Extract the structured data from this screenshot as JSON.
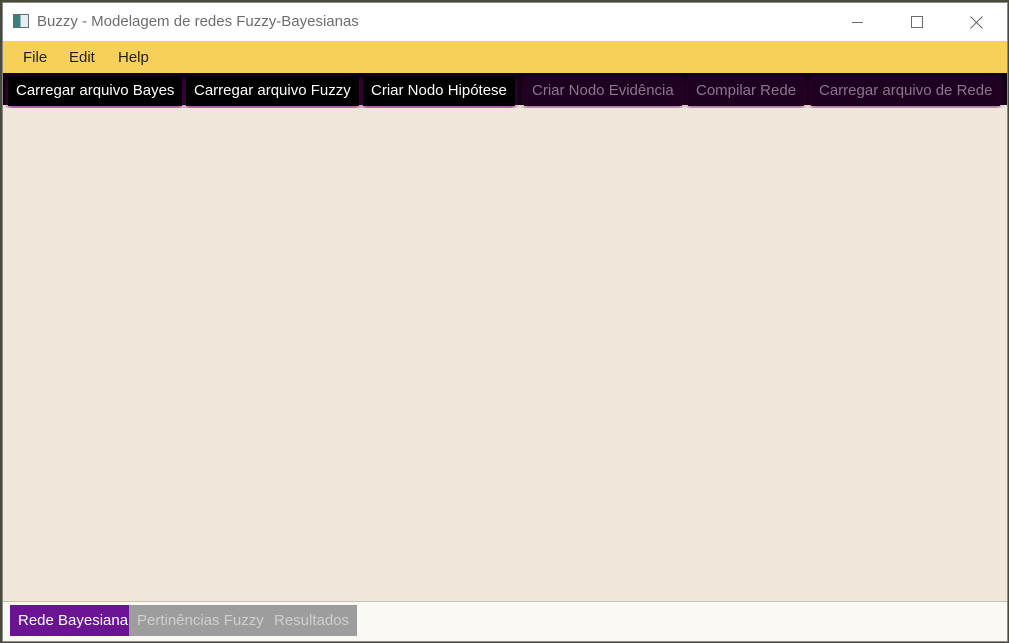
{
  "window": {
    "title": "Buzzy - Modelagem de redes Fuzzy-Bayesianas"
  },
  "menu": {
    "items": [
      {
        "label": "File"
      },
      {
        "label": "Edit"
      },
      {
        "label": "Help"
      }
    ]
  },
  "toolbar": {
    "buttons": [
      {
        "label": "Carregar arquivo Bayes",
        "enabled": true
      },
      {
        "label": "Carregar arquivo Fuzzy",
        "enabled": true
      },
      {
        "label": "Criar Nodo Hipótese",
        "enabled": true
      },
      {
        "label": "Criar Nodo Evidência",
        "enabled": false
      },
      {
        "label": "Compilar Rede",
        "enabled": false
      },
      {
        "label": "Carregar arquivo de Rede",
        "enabled": false
      }
    ]
  },
  "tabs": [
    {
      "label": "Rede Bayesiana",
      "selected": true
    },
    {
      "label": "Pertinências Fuzzy",
      "selected": false
    },
    {
      "label": "Resultados",
      "selected": false
    }
  ],
  "colors": {
    "menubar": "#f7d05a",
    "toolbar_button": "#000000",
    "toolbar_glow": "#820082",
    "canvas": "#efe7d9",
    "active_tab": "#6a1494",
    "inactive_tab": "#9d9d9d"
  },
  "icons": {
    "app": "app-window-icon",
    "minimize": "minimize-icon",
    "maximize": "maximize-icon",
    "close": "close-icon"
  }
}
